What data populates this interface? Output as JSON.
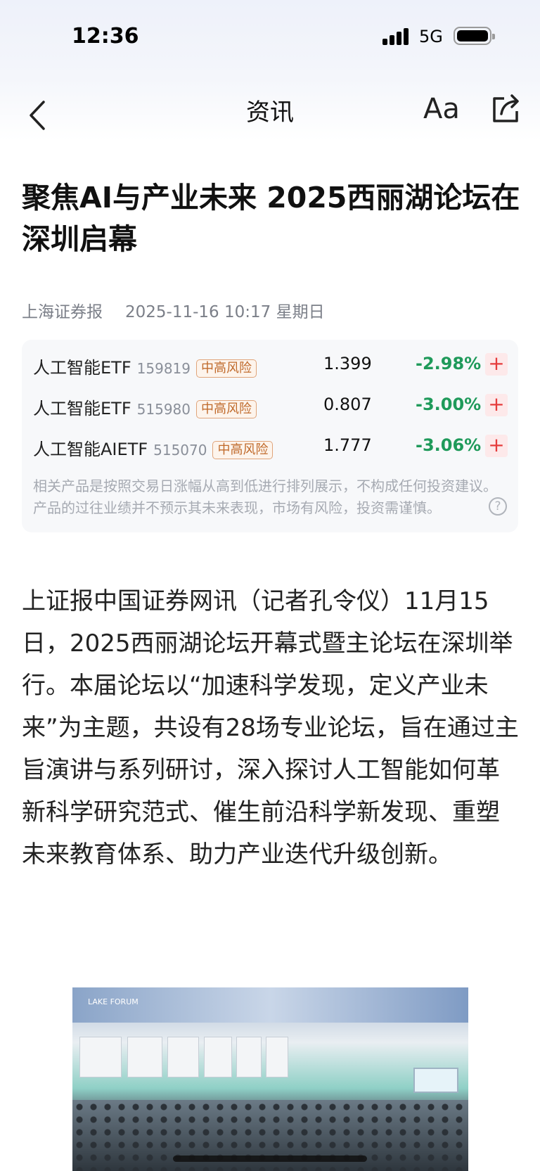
{
  "status_bar": {
    "time": "12:36",
    "network": "5G"
  },
  "nav": {
    "title": "资讯",
    "font_label": "Aa"
  },
  "article": {
    "title": "聚焦AI与产业未来 2025西丽湖论坛在深圳启幕",
    "source": "上海证券报",
    "datetime": "2025-11-16 10:17 星期日",
    "body": "上证报中国证券网讯（记者孔令仪）11月15日，2025西丽湖论坛开幕式暨主论坛在深圳举行。本届论坛以“加速科学发现，定义产业未来”为主题，共设有28场专业论坛，旨在通过主旨演讲与系列研讨，深入探讨人工智能如何革新科学研究范式、催生前沿科学新发现、重塑未来教育体系、助力产业迭代升级创新。",
    "image_caption_text": "LAKE FORUM"
  },
  "funds": {
    "rows": [
      {
        "name": "人工智能ETF",
        "code": "159819",
        "risk": "中高风险",
        "price": "1.399",
        "change": "-2.98%",
        "add": "+"
      },
      {
        "name": "人工智能ETF",
        "code": "515980",
        "risk": "中高风险",
        "price": "0.807",
        "change": "-3.00%",
        "add": "+"
      },
      {
        "name": "人工智能AIETF",
        "code": "515070",
        "risk": "中高风险",
        "price": "1.777",
        "change": "-3.06%",
        "add": "+"
      }
    ],
    "disclaimer": "相关产品是按照交易日涨幅从高到低进行排列展示，不构成任何投资建议。产品的过往业绩并不预示其未来表现，市场有风险，投资需谨慎。",
    "help": "?"
  },
  "colors": {
    "negative": "#1f9a5a",
    "risk": "#c06a2b",
    "add": "#e53c3c"
  }
}
